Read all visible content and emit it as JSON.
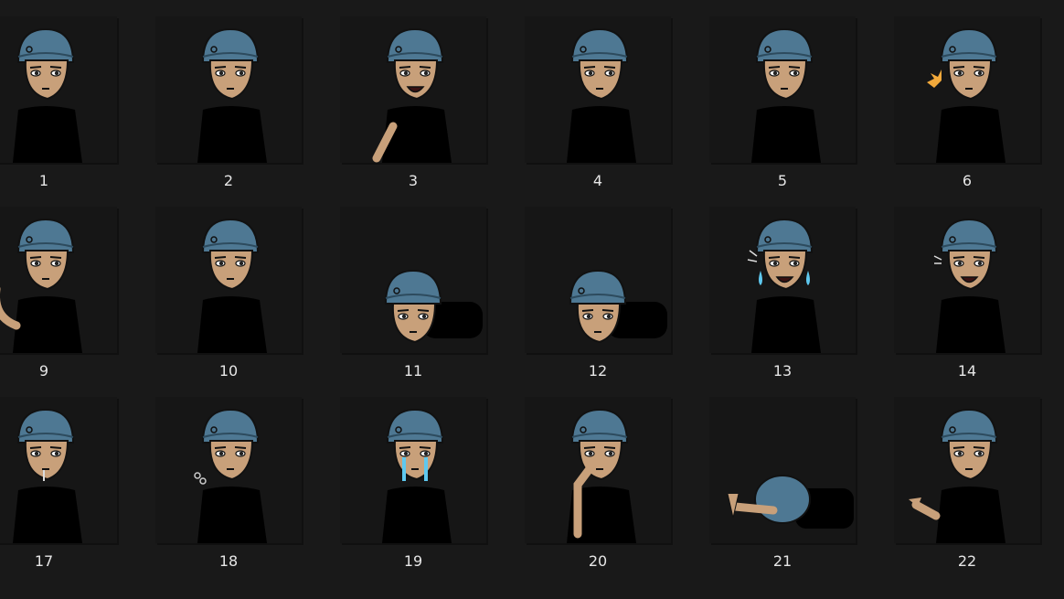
{
  "colors": {
    "background": "#191919",
    "caption": "#e6e6e6",
    "beanie": "#4e7893",
    "skin": "#c8a07a",
    "shirt": "#000000",
    "tears": "#5ec8ef",
    "spark": "#f2a93b"
  },
  "tiles": [
    {
      "label": "1",
      "pose": "neutral"
    },
    {
      "label": "2",
      "pose": "neutral"
    },
    {
      "label": "3",
      "pose": "laugh-arms"
    },
    {
      "label": "4",
      "pose": "neutral"
    },
    {
      "label": "5",
      "pose": "neutral"
    },
    {
      "label": "6",
      "pose": "spark"
    },
    {
      "label": "9",
      "pose": "wave"
    },
    {
      "label": "10",
      "pose": "neutral"
    },
    {
      "label": "11",
      "pose": "lying"
    },
    {
      "label": "12",
      "pose": "lying"
    },
    {
      "label": "13",
      "pose": "cry-laugh"
    },
    {
      "label": "14",
      "pose": "grin"
    },
    {
      "label": "17",
      "pose": "drool"
    },
    {
      "label": "18",
      "pose": "sigh"
    },
    {
      "label": "19",
      "pose": "cry"
    },
    {
      "label": "20",
      "pose": "facepalm"
    },
    {
      "label": "21",
      "pose": "collapsed"
    },
    {
      "label": "22",
      "pose": "shrug"
    }
  ]
}
